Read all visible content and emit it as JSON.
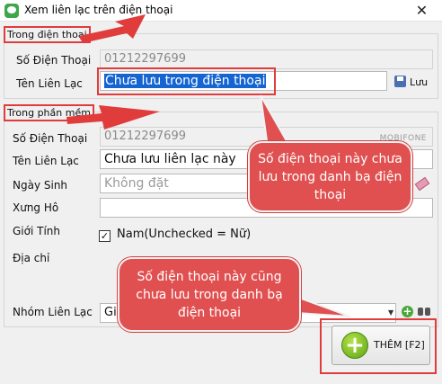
{
  "window": {
    "title": "Xem liên lạc trên điện thoại",
    "close_symbol": "✕",
    "app_icon": "chat-bubble-icon"
  },
  "phone_group": {
    "title": "Trong điện thoại",
    "phone_label": "Số Điện Thoại",
    "phone_value": "01212297699",
    "name_label": "Tên Liên Lạc",
    "name_value": "Chưa lưu trong điện thoại",
    "save_label": "Lưu",
    "save_icon": "save-disk-icon"
  },
  "software_group": {
    "title": "Trong phần mềm",
    "phone_label": "Số Điện Thoại",
    "phone_value": "01212297699",
    "carrier": "MOBIFONE",
    "name_label": "Tên Liên Lạc",
    "name_value": "Chưa lưu liên lạc này",
    "birthday_label": "Ngày Sinh",
    "birthday_placeholder": "Không đặt",
    "title_label": "Xưng Hô",
    "title_value": "",
    "gender_label": "Giới Tính",
    "gender_check": "✓",
    "gender_text": "Nam(Unchecked = Nữ)",
    "address_label": "Địa chỉ",
    "group_label": "Nhóm Liên Lạc",
    "group_value_visible": "Gi",
    "dropdown_arrow": "▼",
    "plus_symbol": "+"
  },
  "add_button": {
    "label": "THÊM [F2]",
    "plus_symbol": "+"
  },
  "callouts": {
    "callout_1": "Số điện thoại này chưa lưu trong danh bạ điện thoại",
    "callout_2": "Số điện thoại này cũng chưa lưu trong danh bạ điện thoại"
  },
  "colors": {
    "highlight": "#e03c3c",
    "callout_fill": "#e05050",
    "selection": "#1464d2"
  }
}
